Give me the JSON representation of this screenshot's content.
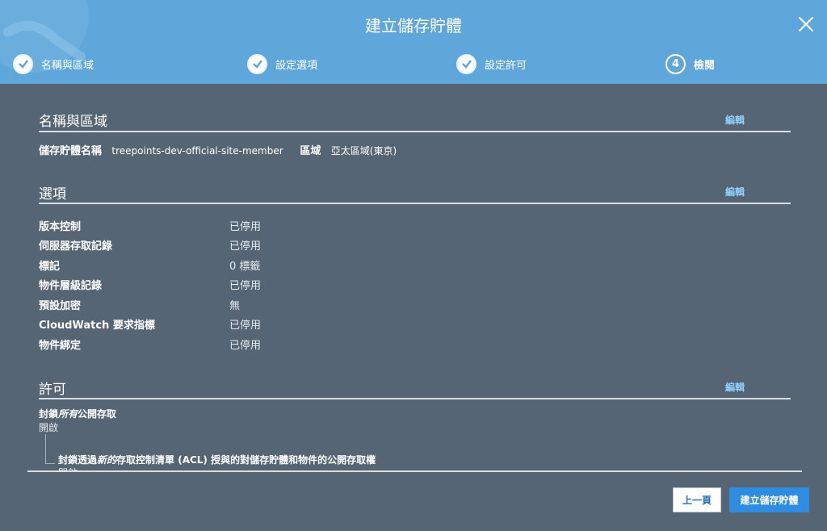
{
  "header": {
    "title": "建立儲存貯體"
  },
  "steps": [
    {
      "label": "名稱與區域",
      "state": "done"
    },
    {
      "label": "設定選項",
      "state": "done"
    },
    {
      "label": "設定許可",
      "state": "done"
    },
    {
      "label": "檢閱",
      "state": "active",
      "number": "4"
    }
  ],
  "sections": {
    "name_region": {
      "title": "名稱與區域",
      "edit": "編輯",
      "bucket_name_label": "儲存貯體名稱",
      "bucket_name": "treepoints-dev-official-site-member",
      "region_label": "區域",
      "region": "亞太區域(東京)"
    },
    "options": {
      "title": "選項",
      "edit": "編輯",
      "rows": [
        {
          "label": "版本控制",
          "value": "已停用"
        },
        {
          "label": "伺服器存取記錄",
          "value": "已停用"
        },
        {
          "label": "標記",
          "value": "0 標籤"
        },
        {
          "label": "物件層級記錄",
          "value": "已停用"
        },
        {
          "label": "預設加密",
          "value": "無"
        },
        {
          "label": "CloudWatch 要求指標",
          "value": "已停用"
        },
        {
          "label": "物件綁定",
          "value": "已停用"
        }
      ]
    },
    "permissions": {
      "title": "許可",
      "edit": "編輯",
      "block_prefix": "封鎖",
      "block_emph": "所有",
      "block_suffix": "公開存取",
      "block_value": "開啟",
      "sub_prefix": "封鎖透過",
      "sub_emph": "新的",
      "sub_suffix": "存取控制清單 (ACL) 授與的對儲存貯體和物件的公開存取權",
      "sub_value": "開啟"
    }
  },
  "footer": {
    "prev_label": "上一頁",
    "create_label": "建立儲存貯體"
  },
  "colors": {
    "header_bg": "#5fa7da",
    "body_bg": "#566574",
    "link": "#8fd0ff",
    "primary_button": "#2e8de0"
  },
  "icons": {
    "close": "close-icon",
    "check": "check-icon"
  }
}
